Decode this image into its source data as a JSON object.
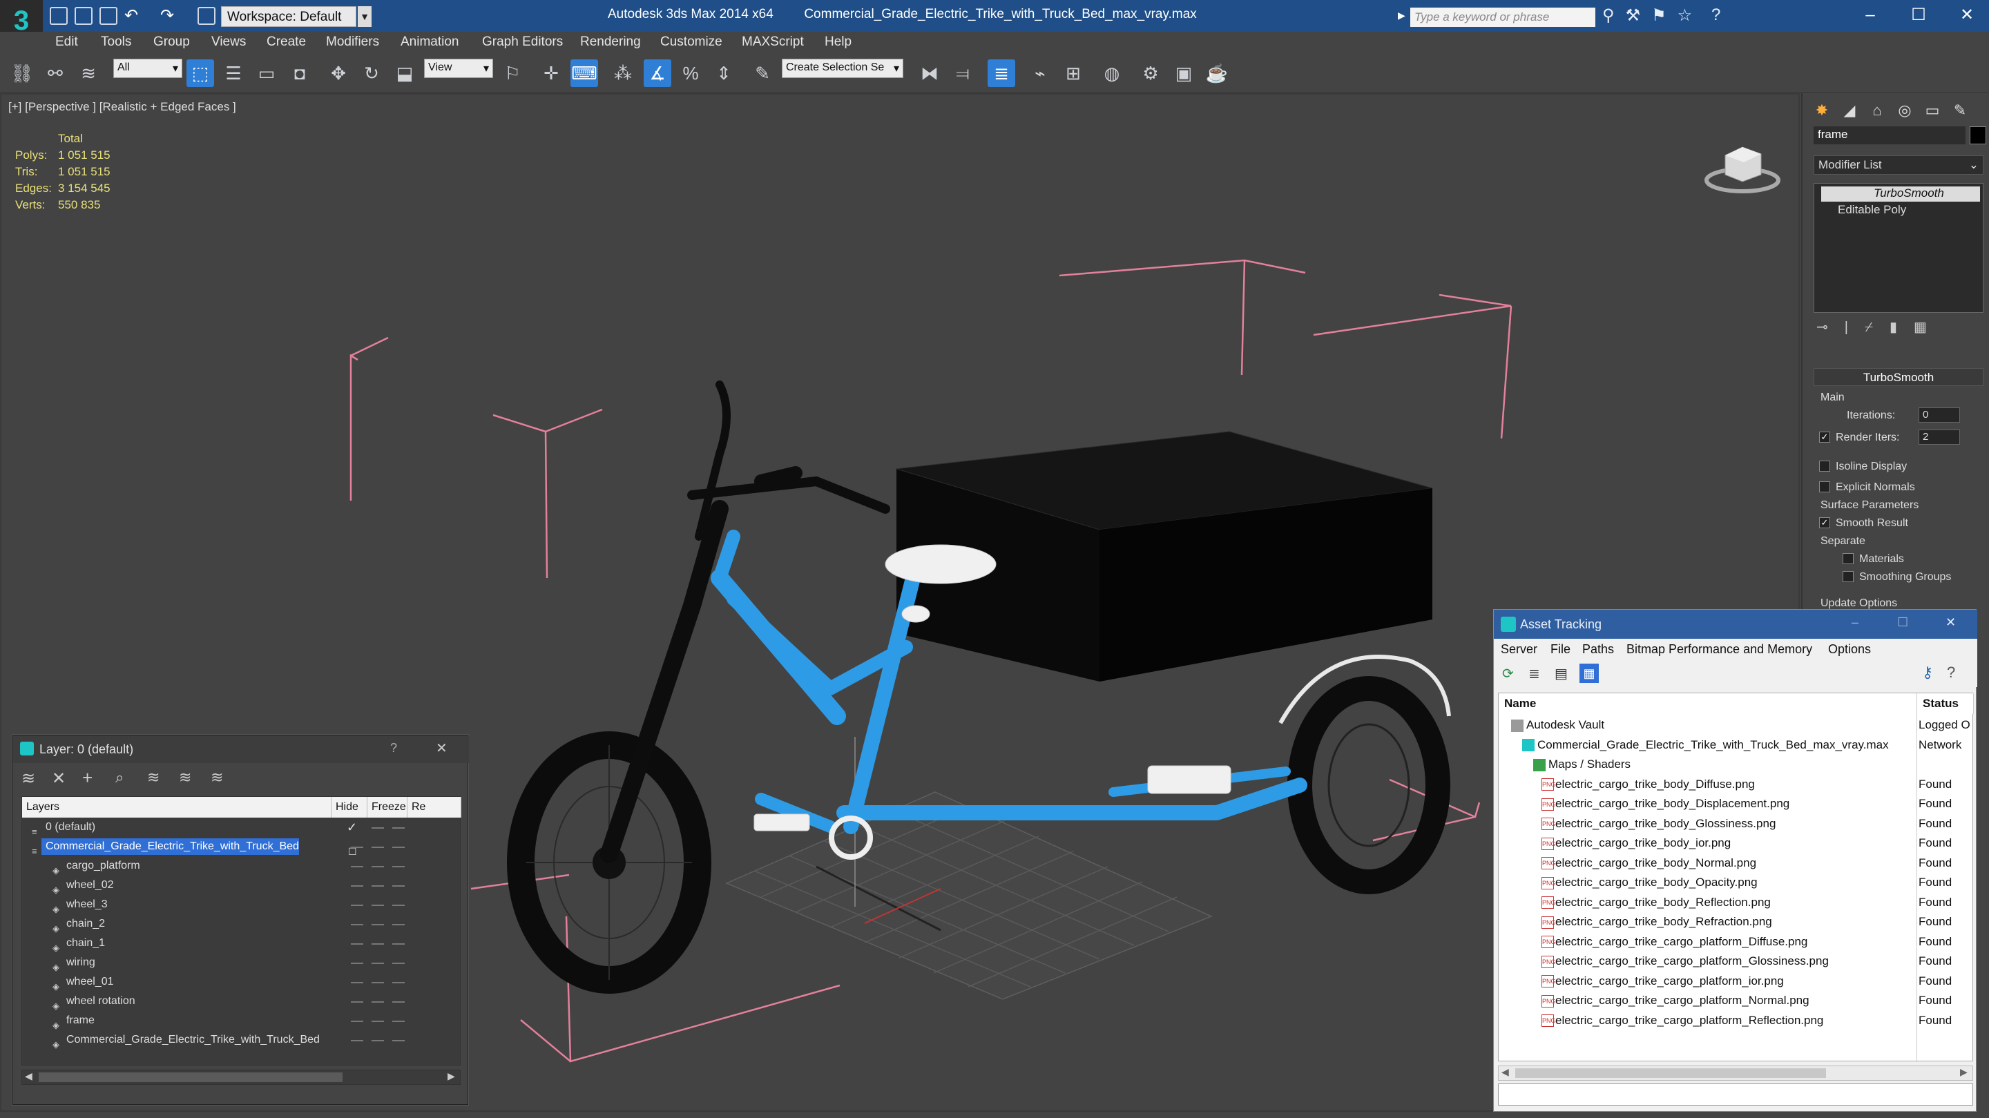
{
  "app": {
    "workspace": "Workspace: Default",
    "product": "Autodesk 3ds Max  2014 x64",
    "file": "Commercial_Grade_Electric_Trike_with_Truck_Bed_max_vray.max",
    "search_placeholder": "Type a keyword or phrase",
    "accent_color": "#1f4e88"
  },
  "menu": [
    "Edit",
    "Tools",
    "Group",
    "Views",
    "Create",
    "Modifiers",
    "Animation",
    "Graph Editors",
    "Rendering",
    "Customize",
    "MAXScript",
    "Help"
  ],
  "toolbar": {
    "filter": "All",
    "ref_coord": "View",
    "selection_set": "Create Selection Se"
  },
  "viewport": {
    "label": "[+] [Perspective ] [Realistic + Edged Faces ]",
    "stats_header": "Total",
    "stats": [
      {
        "label": "Polys:",
        "value": "1 051 515"
      },
      {
        "label": "Tris:",
        "value": "1 051 515"
      },
      {
        "label": "Edges:",
        "value": "3 154 545"
      },
      {
        "label": "Verts:",
        "value": "550 835"
      }
    ]
  },
  "command_panel": {
    "object_name": "frame",
    "modifier_list": "Modifier List",
    "stack": [
      "TurboSmooth",
      "Editable Poly"
    ],
    "rollout": "TurboSmooth",
    "main_label": "Main",
    "iterations_label": "Iterations:",
    "iterations": "0",
    "render_iters_label": "Render Iters:",
    "render_iters": "2",
    "isoline": "Isoline Display",
    "explicit": "Explicit Normals",
    "surface_params": "Surface Parameters",
    "smooth_result": "Smooth Result",
    "separate": "Separate",
    "materials": "Materials",
    "smoothing_groups": "Smoothing Groups",
    "update_options": "Update Options"
  },
  "layer_window": {
    "title": "Layer: 0 (default)",
    "help": "?",
    "columns": [
      "Layers",
      "Hide",
      "Freeze",
      "Re"
    ],
    "rows": [
      {
        "name": "0 (default)",
        "indent": 1,
        "selected": false
      },
      {
        "name": "Commercial_Grade_Electric_Trike_with_Truck_Bed",
        "indent": 1,
        "selected": true
      },
      {
        "name": "cargo_platform",
        "indent": 2,
        "selected": false
      },
      {
        "name": "wheel_02",
        "indent": 2,
        "selected": false
      },
      {
        "name": "wheel_3",
        "indent": 2,
        "selected": false
      },
      {
        "name": "chain_2",
        "indent": 2,
        "selected": false
      },
      {
        "name": "chain_1",
        "indent": 2,
        "selected": false
      },
      {
        "name": "wiring",
        "indent": 2,
        "selected": false
      },
      {
        "name": "wheel_01",
        "indent": 2,
        "selected": false
      },
      {
        "name": "wheel rotation",
        "indent": 2,
        "selected": false
      },
      {
        "name": "frame",
        "indent": 2,
        "selected": false
      },
      {
        "name": "Commercial_Grade_Electric_Trike_with_Truck_Bed",
        "indent": 2,
        "selected": false
      }
    ]
  },
  "asset_window": {
    "title": "Asset Tracking",
    "menu": [
      "Server",
      "File",
      "Paths",
      "Bitmap Performance and Memory",
      "Options"
    ],
    "columns": [
      "Name",
      "Status"
    ],
    "rows": [
      {
        "name": "Autodesk Vault",
        "status": "Logged O",
        "level": 1,
        "icon": "vault"
      },
      {
        "name": "Commercial_Grade_Electric_Trike_with_Truck_Bed_max_vray.max",
        "status": "Network",
        "level": 2,
        "icon": "max"
      },
      {
        "name": "Maps / Shaders",
        "status": "",
        "level": 3,
        "icon": "maps"
      },
      {
        "name": "electric_cargo_trike_body_Diffuse.png",
        "status": "Found",
        "level": 4,
        "icon": "png"
      },
      {
        "name": "electric_cargo_trike_body_Displacement.png",
        "status": "Found",
        "level": 4,
        "icon": "png"
      },
      {
        "name": "electric_cargo_trike_body_Glossiness.png",
        "status": "Found",
        "level": 4,
        "icon": "png"
      },
      {
        "name": "electric_cargo_trike_body_ior.png",
        "status": "Found",
        "level": 4,
        "icon": "png"
      },
      {
        "name": "electric_cargo_trike_body_Normal.png",
        "status": "Found",
        "level": 4,
        "icon": "png"
      },
      {
        "name": "electric_cargo_trike_body_Opacity.png",
        "status": "Found",
        "level": 4,
        "icon": "png"
      },
      {
        "name": "electric_cargo_trike_body_Reflection.png",
        "status": "Found",
        "level": 4,
        "icon": "png"
      },
      {
        "name": "electric_cargo_trike_body_Refraction.png",
        "status": "Found",
        "level": 4,
        "icon": "png"
      },
      {
        "name": "electric_cargo_trike_cargo_platform_Diffuse.png",
        "status": "Found",
        "level": 4,
        "icon": "png"
      },
      {
        "name": "electric_cargo_trike_cargo_platform_Glossiness.png",
        "status": "Found",
        "level": 4,
        "icon": "png"
      },
      {
        "name": "electric_cargo_trike_cargo_platform_ior.png",
        "status": "Found",
        "level": 4,
        "icon": "png"
      },
      {
        "name": "electric_cargo_trike_cargo_platform_Normal.png",
        "status": "Found",
        "level": 4,
        "icon": "png"
      },
      {
        "name": "electric_cargo_trike_cargo_platform_Reflection.png",
        "status": "Found",
        "level": 4,
        "icon": "png"
      }
    ]
  }
}
